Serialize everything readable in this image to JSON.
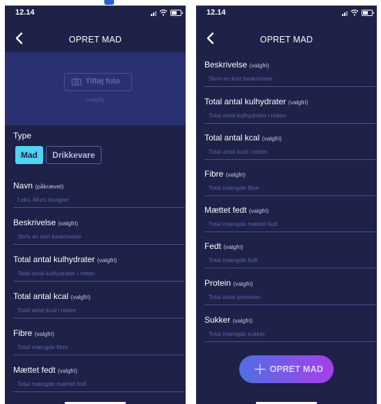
{
  "status_bar": {
    "time": "12.14"
  },
  "colors": {
    "background": "#1e2148",
    "photo_area": "#2a3172",
    "accent_cyan": "#4fd4f2",
    "button_gradient_start": "#4f70e4",
    "button_gradient_end": "#a83ee8"
  },
  "screen1": {
    "title": "OPRET MAD",
    "back_icon": "chevron-left-icon",
    "photo": {
      "button_label": "Tilføj foto",
      "icon": "camera-icon",
      "optional_text": "(valgfri)"
    },
    "type": {
      "label": "Type",
      "options": [
        {
          "label": "Mad",
          "selected": true
        },
        {
          "label": "Drikkevare",
          "selected": false
        }
      ]
    },
    "fields": [
      {
        "label": "Navn",
        "optional": "(påkrævet)",
        "placeholder": "f.eks. Mors lasagne"
      },
      {
        "label": "Beskrivelse",
        "optional": "(valgfri)",
        "placeholder": "Skriv en kort beskrivelse"
      },
      {
        "label": "Total antal kulhydrater",
        "optional": "(valgfri)",
        "placeholder": "Total antal kulhydrater i retten"
      },
      {
        "label": "Total antal kcal",
        "optional": "(valgfri)",
        "placeholder": "Total antal kcal i retten"
      },
      {
        "label": "Fibre",
        "optional": "(valgfri)",
        "placeholder": "Total mængde fibre"
      },
      {
        "label": "Mættet fedt",
        "optional": "(valgfri)",
        "placeholder": "Total mængde mættet fedt"
      }
    ]
  },
  "screen2": {
    "title": "OPRET MAD",
    "back_icon": "chevron-left-icon",
    "fields": [
      {
        "label": "Beskrivelse",
        "optional": "(valgfri)",
        "placeholder": "Skriv en kort beskrivelse"
      },
      {
        "label": "Total antal kulhydrater",
        "optional": "(valgfri)",
        "placeholder": "Total antal kulhydrater i retten"
      },
      {
        "label": "Total antal kcal",
        "optional": "(valgfri)",
        "placeholder": "Total antal kcal i retten"
      },
      {
        "label": "Fibre",
        "optional": "(valgfri)",
        "placeholder": "Total mængde fibre"
      },
      {
        "label": "Mættet fedt",
        "optional": "(valgfri)",
        "placeholder": "Total mængde mættet fedt"
      },
      {
        "label": "Fedt",
        "optional": "(valgfri)",
        "placeholder": "Total mængde fedt"
      },
      {
        "label": "Protein",
        "optional": "(valgfri)",
        "placeholder": "Total antal proteiner"
      },
      {
        "label": "Sukker",
        "optional": "(valgfri)",
        "placeholder": "Total mængde sukker"
      }
    ],
    "create_button": {
      "label": "OPRET MAD",
      "icon": "plus-icon"
    }
  }
}
